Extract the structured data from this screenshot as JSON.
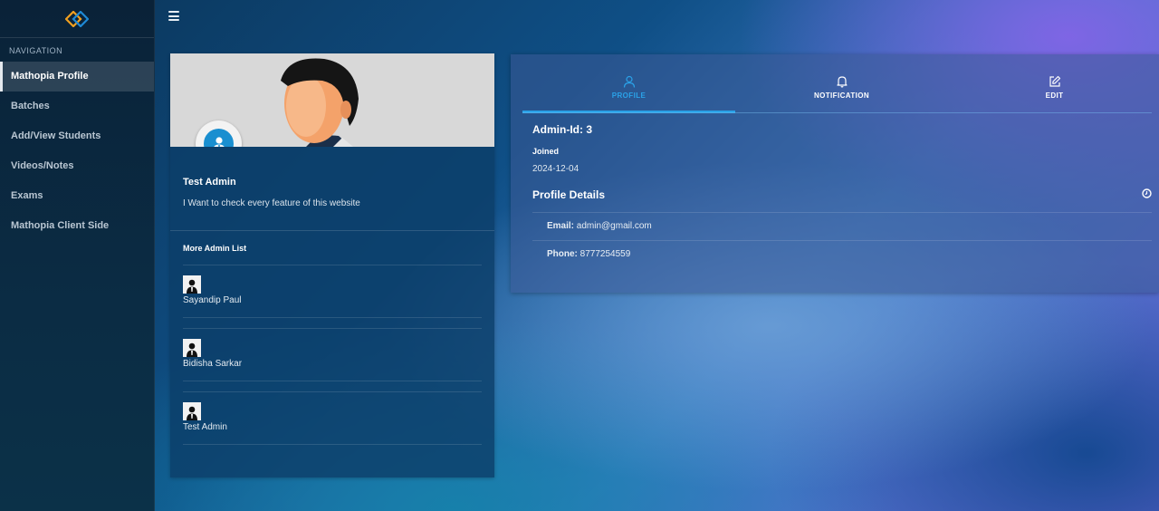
{
  "sidebar": {
    "heading": "NAVIGATION",
    "items": [
      {
        "label": "Mathopia Profile",
        "active": true
      },
      {
        "label": "Batches"
      },
      {
        "label": "Add/View Students"
      },
      {
        "label": "Videos/Notes"
      },
      {
        "label": "Exams"
      },
      {
        "label": "Mathopia Client Side"
      }
    ]
  },
  "profile": {
    "name": "Test Admin",
    "bio": "I Want to check every feature of this website",
    "list_title": "More Admin List",
    "admins": [
      {
        "name": "Sayandip Paul"
      },
      {
        "name": "Bidisha Sarkar"
      },
      {
        "name": "Test Admin"
      }
    ]
  },
  "tabs": [
    {
      "label": "PROFILE",
      "icon": "user-icon",
      "active": true
    },
    {
      "label": "NOTIFICATION",
      "icon": "bell-icon"
    },
    {
      "label": "EDIT",
      "icon": "edit-icon"
    }
  ],
  "details": {
    "admin_id": "Admin-Id: 3",
    "joined_label": "Joined",
    "joined_value": "2024-12-04",
    "section_title": "Profile Details",
    "email_label": "Email:",
    "email_value": "admin@gmail.com",
    "phone_label": "Phone:",
    "phone_value": "8777254559"
  },
  "colors": {
    "accent": "#2aa2e8",
    "logo_blue": "#1e8ad6",
    "logo_orange": "#f0a020"
  }
}
